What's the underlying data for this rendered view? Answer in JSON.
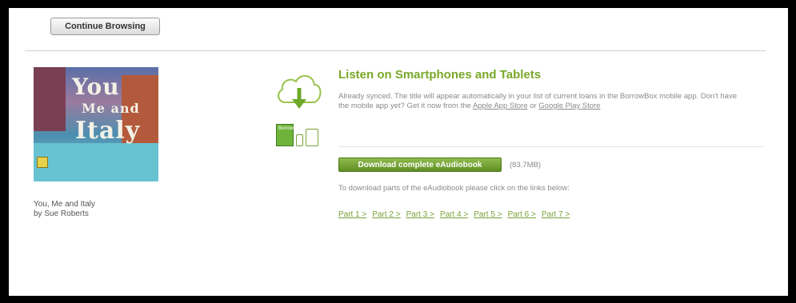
{
  "nav": {
    "continue_label": "Continue Browsing"
  },
  "book": {
    "title": "You, Me and Italy",
    "author": "by Sue Roberts",
    "cover_words": [
      "You",
      "Me and",
      "Italy"
    ]
  },
  "listen": {
    "heading": "Listen on Smartphones and Tablets",
    "desc_prefix": "Already synced. The title will appear automatically in your list of current loans in the BorrowBox mobile app. Don't have the mobile app yet? Get it now from the ",
    "apple_link": "Apple App Store",
    "desc_or": " or ",
    "google_link": "Google Play Store",
    "device_label": "BorrowBox"
  },
  "download": {
    "button_label": "Download complete eAudiobook",
    "size": "(83.7MB)",
    "parts_note": "To download parts of the eAudiobook please click on the links below:",
    "parts": [
      "Part 1 >",
      "Part 2 >",
      "Part 3 >",
      "Part 4 >",
      "Part 5 >",
      "Part 6 >",
      "Part 7 >"
    ]
  },
  "colors": {
    "accent": "#79a828",
    "button_green": "#5f8f25",
    "link_green": "#7aa13a"
  },
  "icons": [
    "cloud-download-icon",
    "phone-icon",
    "tablet-icon"
  ]
}
